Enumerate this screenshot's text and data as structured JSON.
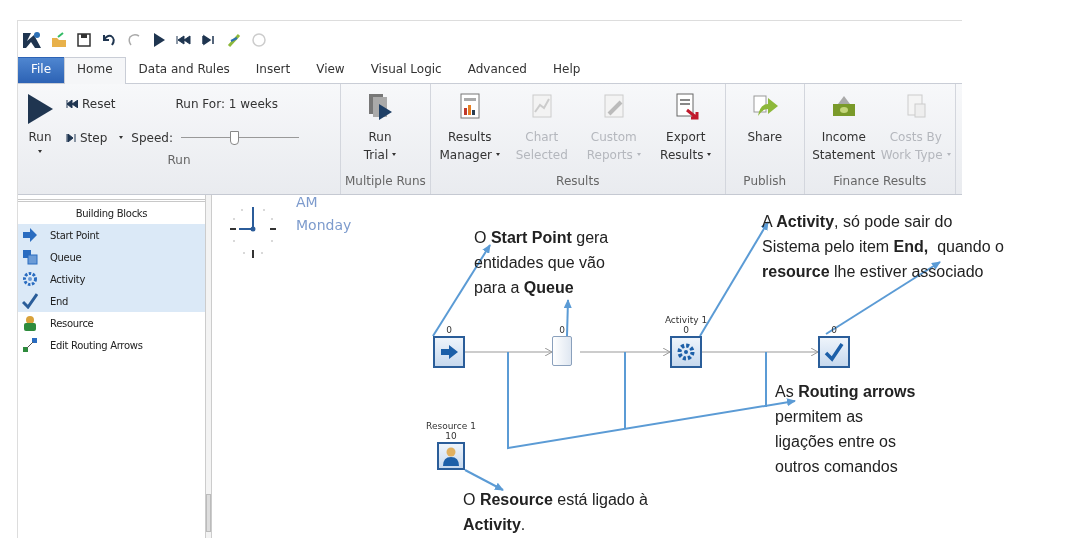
{
  "tabs": [
    {
      "label": "File",
      "kind": "file",
      "selected": false
    },
    {
      "label": "Home",
      "kind": "tab",
      "selected": true
    },
    {
      "label": "Data and Rules",
      "kind": "tab",
      "selected": false
    },
    {
      "label": "Insert",
      "kind": "tab",
      "selected": false
    },
    {
      "label": "View",
      "kind": "tab",
      "selected": false
    },
    {
      "label": "Visual Logic",
      "kind": "tab",
      "selected": false
    },
    {
      "label": "Advanced",
      "kind": "tab",
      "selected": false
    },
    {
      "label": "Help",
      "kind": "tab",
      "selected": false
    }
  ],
  "ribbon": {
    "run_group": {
      "label": "Run",
      "run": {
        "label": "Run",
        "dropdown": true
      },
      "reset": "Reset",
      "step": {
        "label": "Step",
        "dropdown": true
      },
      "speed_label": "Speed:",
      "speed": {
        "level": 0.45
      },
      "run_for": "Run For: 1 weeks"
    },
    "groups": [
      {
        "label": "Multiple Runs",
        "buttons": [
          {
            "label": "Run\nTrial",
            "dropdown": true,
            "disabled": false
          }
        ]
      },
      {
        "label": "Results",
        "buttons": [
          {
            "label": "Results\nManager",
            "dropdown": true,
            "disabled": false
          },
          {
            "label": "Chart\nSelected",
            "dropdown": false,
            "disabled": true
          },
          {
            "label": "Custom\nReports",
            "dropdown": true,
            "disabled": true
          },
          {
            "label": "Export\nResults",
            "dropdown": true,
            "disabled": false
          }
        ]
      },
      {
        "label": "Publish",
        "buttons": [
          {
            "label": "Share",
            "dropdown": false,
            "disabled": false
          }
        ]
      },
      {
        "label": "Finance Results",
        "buttons": [
          {
            "label": "Income\nStatement",
            "dropdown": false,
            "disabled": false
          },
          {
            "label": "Costs By\nWork Type",
            "dropdown": true,
            "disabled": true
          }
        ]
      }
    ]
  },
  "sidebar": {
    "title": "Building Blocks",
    "items": [
      {
        "label": "Start Point",
        "selected": true
      },
      {
        "label": "Queue",
        "selected": true
      },
      {
        "label": "Activity",
        "selected": true
      },
      {
        "label": "End",
        "selected": true
      },
      {
        "label": "Resource",
        "selected": false
      },
      {
        "label": "Edit Routing Arrows",
        "selected": false
      }
    ]
  },
  "canvas": {
    "clock": {
      "meridiem": "AM",
      "day": "Monday"
    },
    "nodes": [
      {
        "kind": "start",
        "count": "0"
      },
      {
        "kind": "queue",
        "count": "0"
      },
      {
        "kind": "activity",
        "title": "Activity 1",
        "count": "0"
      },
      {
        "kind": "end",
        "count": "0"
      },
      {
        "kind": "resource",
        "title": "Resource 1",
        "count": "10"
      }
    ],
    "annotations": [
      {
        "text": "O **Start Point** gera\nentidades que vão\npara a **Queue**"
      },
      {
        "text": "A **Activity**, só pode sair do\nSistema pelo item **End,**  quando o\n**resource** lhe estiver associado"
      },
      {
        "text": "As **Routing arrows**\npermitem as\nligações entre os\noutros comandos"
      },
      {
        "text": "O **Resource** está ligado à\n**Activity**."
      }
    ]
  }
}
